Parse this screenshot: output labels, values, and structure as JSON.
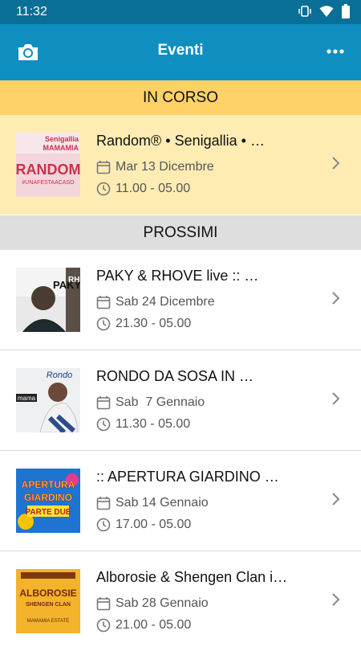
{
  "status": {
    "time": "11:32"
  },
  "appbar": {
    "title": "Eventi"
  },
  "sections": {
    "current": "IN CORSO",
    "upcoming": "PROSSIMI"
  },
  "events": [
    {
      "title": "Random® • Senigallia • …",
      "date": "Mar 13 Dicembre",
      "time": "11.00 - 05.00",
      "thumb_text": [
        "Senigallia",
        "MAMAMIA",
        "RANDOM",
        "#UNAFESTAACASO"
      ]
    },
    {
      "title": "PAKY & RHOVE live :: …",
      "date": "Sab 24 Dicembre",
      "time": "21.30 - 05.00",
      "thumb_text": [
        "PAKY",
        "RH"
      ]
    },
    {
      "title": "RONDO DA SOSA IN …",
      "date": "Sab  7 Gennaio",
      "time": "11.30 - 05.00",
      "thumb_text": [
        "Rondo",
        "mama"
      ]
    },
    {
      "title": ":: APERTURA GIARDINO …",
      "date": "Sab 14 Gennaio",
      "time": "17.00 - 05.00",
      "thumb_text": [
        "APERTURA",
        "GIARDINO",
        "PARTE DUE"
      ]
    },
    {
      "title": "Alborosie & Shengen Clan i…",
      "date": "Sab 28 Gennaio",
      "time": "21.00 - 05.00",
      "thumb_text": [
        "ALBOROSIE",
        "SHENGEN CLAN",
        "MAMAMIA ESTATE"
      ]
    }
  ],
  "colors": {
    "statusbar": "#0a6f96",
    "appbar": "#0f8ec0",
    "current_header": "#ffd166",
    "current_row": "#ffecb3",
    "upcoming_header": "#dedede"
  },
  "icons": [
    "wifi-icon",
    "battery-icon",
    "vibrate-icon",
    "camera-icon",
    "more-icon",
    "calendar-icon",
    "clock-icon",
    "chevron-right-icon"
  ]
}
